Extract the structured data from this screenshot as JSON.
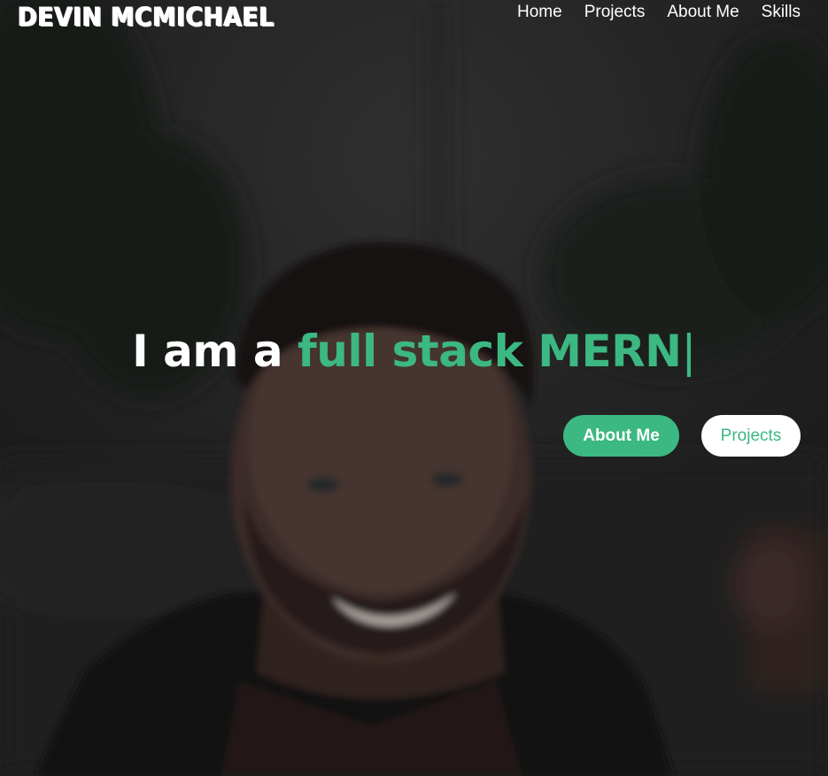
{
  "header": {
    "logo_text": "DEVIN MCMICHAEL",
    "nav": [
      {
        "label": "Home"
      },
      {
        "label": "Projects"
      },
      {
        "label": "About Me"
      },
      {
        "label": "Skills"
      }
    ]
  },
  "hero": {
    "static_text": "I am a ",
    "typed_text": "full stack MERN",
    "cursor": "|",
    "buttons": {
      "about": "About Me",
      "projects": "Projects"
    }
  },
  "colors": {
    "accent": "#3cb882",
    "text": "#ffffff",
    "button_alt_bg": "#ffffff"
  }
}
